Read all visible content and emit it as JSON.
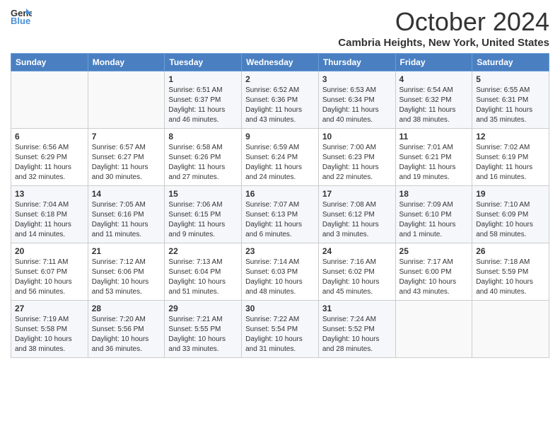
{
  "header": {
    "logo_general": "General",
    "logo_blue": "Blue",
    "month_title": "October 2024",
    "subtitle": "Cambria Heights, New York, United States"
  },
  "weekdays": [
    "Sunday",
    "Monday",
    "Tuesday",
    "Wednesday",
    "Thursday",
    "Friday",
    "Saturday"
  ],
  "weeks": [
    [
      null,
      null,
      {
        "day": 1,
        "sunrise": "Sunrise: 6:51 AM",
        "sunset": "Sunset: 6:37 PM",
        "daylight": "Daylight: 11 hours and 46 minutes."
      },
      {
        "day": 2,
        "sunrise": "Sunrise: 6:52 AM",
        "sunset": "Sunset: 6:36 PM",
        "daylight": "Daylight: 11 hours and 43 minutes."
      },
      {
        "day": 3,
        "sunrise": "Sunrise: 6:53 AM",
        "sunset": "Sunset: 6:34 PM",
        "daylight": "Daylight: 11 hours and 40 minutes."
      },
      {
        "day": 4,
        "sunrise": "Sunrise: 6:54 AM",
        "sunset": "Sunset: 6:32 PM",
        "daylight": "Daylight: 11 hours and 38 minutes."
      },
      {
        "day": 5,
        "sunrise": "Sunrise: 6:55 AM",
        "sunset": "Sunset: 6:31 PM",
        "daylight": "Daylight: 11 hours and 35 minutes."
      }
    ],
    [
      {
        "day": 6,
        "sunrise": "Sunrise: 6:56 AM",
        "sunset": "Sunset: 6:29 PM",
        "daylight": "Daylight: 11 hours and 32 minutes."
      },
      {
        "day": 7,
        "sunrise": "Sunrise: 6:57 AM",
        "sunset": "Sunset: 6:27 PM",
        "daylight": "Daylight: 11 hours and 30 minutes."
      },
      {
        "day": 8,
        "sunrise": "Sunrise: 6:58 AM",
        "sunset": "Sunset: 6:26 PM",
        "daylight": "Daylight: 11 hours and 27 minutes."
      },
      {
        "day": 9,
        "sunrise": "Sunrise: 6:59 AM",
        "sunset": "Sunset: 6:24 PM",
        "daylight": "Daylight: 11 hours and 24 minutes."
      },
      {
        "day": 10,
        "sunrise": "Sunrise: 7:00 AM",
        "sunset": "Sunset: 6:23 PM",
        "daylight": "Daylight: 11 hours and 22 minutes."
      },
      {
        "day": 11,
        "sunrise": "Sunrise: 7:01 AM",
        "sunset": "Sunset: 6:21 PM",
        "daylight": "Daylight: 11 hours and 19 minutes."
      },
      {
        "day": 12,
        "sunrise": "Sunrise: 7:02 AM",
        "sunset": "Sunset: 6:19 PM",
        "daylight": "Daylight: 11 hours and 16 minutes."
      }
    ],
    [
      {
        "day": 13,
        "sunrise": "Sunrise: 7:04 AM",
        "sunset": "Sunset: 6:18 PM",
        "daylight": "Daylight: 11 hours and 14 minutes."
      },
      {
        "day": 14,
        "sunrise": "Sunrise: 7:05 AM",
        "sunset": "Sunset: 6:16 PM",
        "daylight": "Daylight: 11 hours and 11 minutes."
      },
      {
        "day": 15,
        "sunrise": "Sunrise: 7:06 AM",
        "sunset": "Sunset: 6:15 PM",
        "daylight": "Daylight: 11 hours and 9 minutes."
      },
      {
        "day": 16,
        "sunrise": "Sunrise: 7:07 AM",
        "sunset": "Sunset: 6:13 PM",
        "daylight": "Daylight: 11 hours and 6 minutes."
      },
      {
        "day": 17,
        "sunrise": "Sunrise: 7:08 AM",
        "sunset": "Sunset: 6:12 PM",
        "daylight": "Daylight: 11 hours and 3 minutes."
      },
      {
        "day": 18,
        "sunrise": "Sunrise: 7:09 AM",
        "sunset": "Sunset: 6:10 PM",
        "daylight": "Daylight: 11 hours and 1 minute."
      },
      {
        "day": 19,
        "sunrise": "Sunrise: 7:10 AM",
        "sunset": "Sunset: 6:09 PM",
        "daylight": "Daylight: 10 hours and 58 minutes."
      }
    ],
    [
      {
        "day": 20,
        "sunrise": "Sunrise: 7:11 AM",
        "sunset": "Sunset: 6:07 PM",
        "daylight": "Daylight: 10 hours and 56 minutes."
      },
      {
        "day": 21,
        "sunrise": "Sunrise: 7:12 AM",
        "sunset": "Sunset: 6:06 PM",
        "daylight": "Daylight: 10 hours and 53 minutes."
      },
      {
        "day": 22,
        "sunrise": "Sunrise: 7:13 AM",
        "sunset": "Sunset: 6:04 PM",
        "daylight": "Daylight: 10 hours and 51 minutes."
      },
      {
        "day": 23,
        "sunrise": "Sunrise: 7:14 AM",
        "sunset": "Sunset: 6:03 PM",
        "daylight": "Daylight: 10 hours and 48 minutes."
      },
      {
        "day": 24,
        "sunrise": "Sunrise: 7:16 AM",
        "sunset": "Sunset: 6:02 PM",
        "daylight": "Daylight: 10 hours and 45 minutes."
      },
      {
        "day": 25,
        "sunrise": "Sunrise: 7:17 AM",
        "sunset": "Sunset: 6:00 PM",
        "daylight": "Daylight: 10 hours and 43 minutes."
      },
      {
        "day": 26,
        "sunrise": "Sunrise: 7:18 AM",
        "sunset": "Sunset: 5:59 PM",
        "daylight": "Daylight: 10 hours and 40 minutes."
      }
    ],
    [
      {
        "day": 27,
        "sunrise": "Sunrise: 7:19 AM",
        "sunset": "Sunset: 5:58 PM",
        "daylight": "Daylight: 10 hours and 38 minutes."
      },
      {
        "day": 28,
        "sunrise": "Sunrise: 7:20 AM",
        "sunset": "Sunset: 5:56 PM",
        "daylight": "Daylight: 10 hours and 36 minutes."
      },
      {
        "day": 29,
        "sunrise": "Sunrise: 7:21 AM",
        "sunset": "Sunset: 5:55 PM",
        "daylight": "Daylight: 10 hours and 33 minutes."
      },
      {
        "day": 30,
        "sunrise": "Sunrise: 7:22 AM",
        "sunset": "Sunset: 5:54 PM",
        "daylight": "Daylight: 10 hours and 31 minutes."
      },
      {
        "day": 31,
        "sunrise": "Sunrise: 7:24 AM",
        "sunset": "Sunset: 5:52 PM",
        "daylight": "Daylight: 10 hours and 28 minutes."
      },
      null,
      null
    ]
  ]
}
